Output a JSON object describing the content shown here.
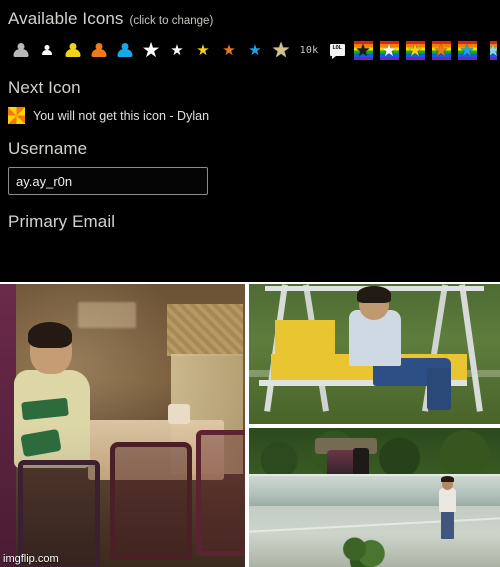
{
  "page": {
    "background_color": "#000000",
    "text_color": "#e8e6e3"
  },
  "available_icons": {
    "heading": "Available Icons",
    "sub_label": "(click to change)",
    "items": [
      {
        "icon": "person-icon",
        "variant": "person-large",
        "color": "#b8b8b8",
        "label": ""
      },
      {
        "icon": "person-icon",
        "variant": "person-small",
        "color": "#ffffff",
        "label": ""
      },
      {
        "icon": "person-icon",
        "variant": "person-large",
        "color": "#f2d21a",
        "label": ""
      },
      {
        "icon": "person-icon",
        "variant": "person-large",
        "color": "#ef7a1a",
        "label": ""
      },
      {
        "icon": "person-icon",
        "variant": "person-large",
        "color": "#1aa6e8",
        "label": ""
      },
      {
        "icon": "star-icon",
        "variant": "star-large",
        "color": "#ffffff",
        "label": ""
      },
      {
        "icon": "star-icon",
        "variant": "star-small",
        "color": "#f5f5f5",
        "label": ""
      },
      {
        "icon": "star-icon",
        "variant": "star-small",
        "color": "#f2d21a",
        "label": ""
      },
      {
        "icon": "star-icon",
        "variant": "star-small",
        "color": "#ef7a1a",
        "label": ""
      },
      {
        "icon": "star-icon",
        "variant": "star-small",
        "color": "#1aa6e8",
        "label": ""
      },
      {
        "icon": "star-icon",
        "variant": "star-large",
        "color": "#d9c28a",
        "label": ""
      },
      {
        "icon": "count-badge",
        "variant": "text",
        "color": "#cfcac3",
        "label": "10k"
      },
      {
        "icon": "lol-bubble-icon",
        "variant": "bubble",
        "color": "#f2f2f2",
        "label": "LOL"
      },
      {
        "icon": "rainbow-star-icon",
        "variant": "rainbow-tile",
        "color": "#1a1a1a",
        "label": ""
      },
      {
        "icon": "rainbow-star-icon",
        "variant": "rainbow-tile",
        "color": "#ffffff",
        "label": ""
      },
      {
        "icon": "rainbow-star-icon",
        "variant": "rainbow-tile",
        "color": "#f2d21a",
        "label": ""
      },
      {
        "icon": "rainbow-star-icon",
        "variant": "rainbow-tile",
        "color": "#ef7a1a",
        "label": ""
      },
      {
        "icon": "rainbow-star-icon",
        "variant": "rainbow-tile",
        "color": "#1aa6e8",
        "label": ""
      },
      {
        "icon": "rainbow-star-icon",
        "variant": "rainbow-tile-clipped",
        "color": "#8ad8f0",
        "label": ""
      }
    ]
  },
  "next_icon": {
    "heading": "Next Icon",
    "icon_name": "pinwheel-icon",
    "text": "You will not get this icon - Dylan"
  },
  "username": {
    "heading": "Username",
    "value": "ay.ay_r0n",
    "placeholder": "Username"
  },
  "primary_email": {
    "heading": "Primary Email"
  },
  "meme": {
    "watermark": "imgflip.com",
    "panels": [
      {
        "name": "sad-pablo-at-table"
      },
      {
        "name": "sad-pablo-on-swing"
      },
      {
        "name": "sad-pablo-in-empty-pool"
      }
    ]
  }
}
